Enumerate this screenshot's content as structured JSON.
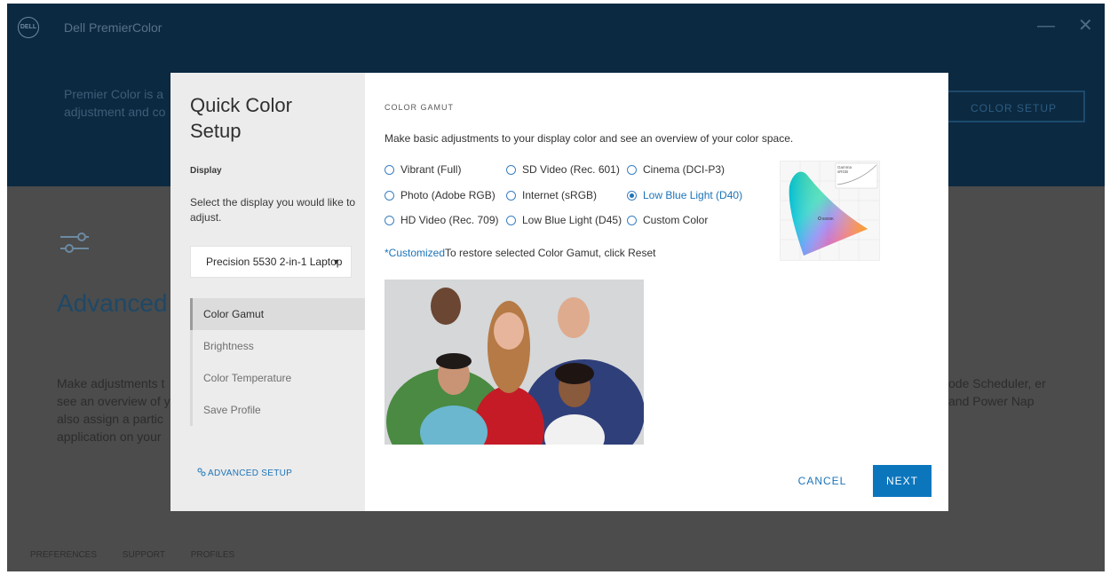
{
  "app": {
    "logo_text": "DELL",
    "title": "Dell PremierColor",
    "minimize_glyph": "—",
    "close_glyph": "✕"
  },
  "background": {
    "hero_text": "Premier Color is a adjustment and co",
    "hero_button": "COLOR SETUP",
    "heading": "Advanced Color Setu",
    "paragraph": "Make adjustments t see an overview of y also assign a partic application on your",
    "right_text": "ode Scheduler, er and Power Nap",
    "footer": {
      "preferences": "PREFERENCES",
      "support": "SUPPORT",
      "profiles": "PROFILES"
    }
  },
  "modal": {
    "title": "Quick Color Setup",
    "display_label": "Display",
    "display_desc": "Select the display you would like to adjust.",
    "display_selected": "Precision 5530 2-in-1 Laptop",
    "nav": [
      {
        "label": "Color Gamut",
        "active": true
      },
      {
        "label": "Brightness",
        "active": false
      },
      {
        "label": "Color Temperature",
        "active": false
      },
      {
        "label": "Save Profile",
        "active": false
      }
    ],
    "advanced_setup": "ADVANCED SETUP",
    "section_label": "COLOR GAMUT",
    "description": "Make basic adjustments to your display color and see an overview of your color space.",
    "gamut_options": [
      "Vibrant (Full)",
      "SD Video (Rec. 601)",
      "Cinema (DCI-P3)",
      "Photo (Adobe RGB)",
      "Internet (sRGB)",
      "Low Blue Light (D40)",
      "HD Video (Rec. 709)",
      "Low Blue Light (D45)",
      "Custom Color"
    ],
    "selected_gamut": "Low Blue Light (D40)",
    "customized_link": "*Customized",
    "customized_text": "To restore selected Color Gamut, click Reset",
    "gamut_chart": {
      "legend_1": "Gamma",
      "legend_2": "sRGB",
      "whitepoint": "5000K"
    },
    "cancel": "CANCEL",
    "next": "NEXT"
  },
  "colors": {
    "accent": "#0c76bd",
    "header_bg": "#0b2941",
    "overlay_bg": "#4c4c4c",
    "sidebar_bg": "#ececec"
  }
}
